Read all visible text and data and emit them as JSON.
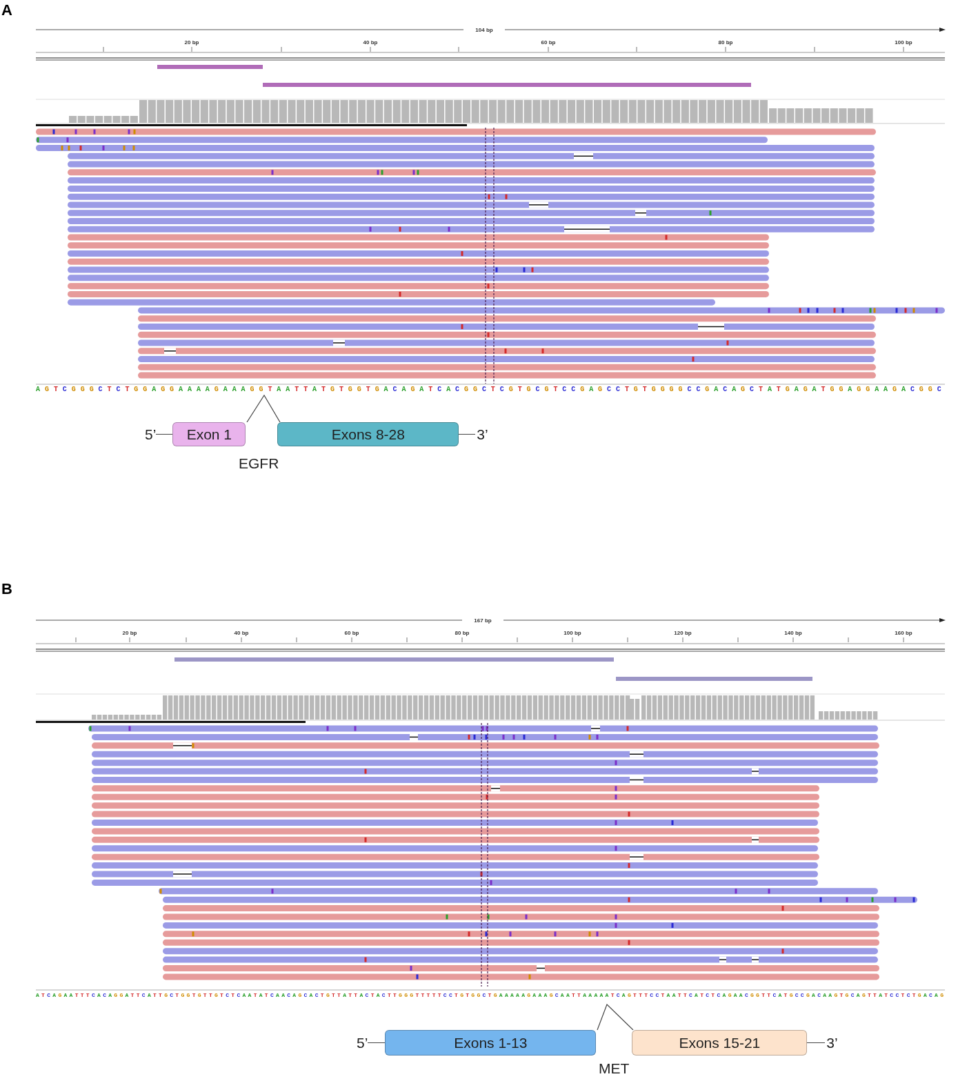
{
  "panels": [
    {
      "label": "A",
      "ruler": {
        "span": "104 bp",
        "ticks": [
          "20 bp",
          "40 bp",
          "60 bp",
          "80 bp",
          "100 bp"
        ]
      },
      "reads": [
        {
          "color": "#e69b9b"
        },
        {
          "color": "#9b9be6"
        },
        {
          "color": "#9b9be6"
        },
        {
          "color": "#9b9be6"
        },
        {
          "color": "#9b9be6"
        },
        {
          "color": "#e69b9b"
        },
        {
          "color": "#9b9be6"
        },
        {
          "color": "#9b9be6"
        },
        {
          "color": "#9b9be6"
        },
        {
          "color": "#9b9be6"
        },
        {
          "color": "#9b9be6"
        },
        {
          "color": "#9b9be6"
        },
        {
          "color": "#9b9be6"
        },
        {
          "color": "#e69b9b"
        },
        {
          "color": "#e69b9b"
        },
        {
          "color": "#9b9be6"
        },
        {
          "color": "#e69b9b"
        },
        {
          "color": "#9b9be6"
        },
        {
          "color": "#9b9be6"
        },
        {
          "color": "#e69b9b"
        },
        {
          "color": "#e69b9b"
        },
        {
          "color": "#9b9be6"
        },
        {
          "color": "#9b9be6"
        },
        {
          "color": "#e69b9b"
        },
        {
          "color": "#9b9be6"
        },
        {
          "color": "#e69b9b"
        },
        {
          "color": "#9b9be6"
        },
        {
          "color": "#e69b9b"
        },
        {
          "color": "#9b9be6"
        },
        {
          "color": "#e69b9b"
        },
        {
          "color": "#e69b9b"
        }
      ],
      "sequence": "AGTCGGGCTCTGGAGGAAAAGAAAGGTAATTATGTGGTGACAGATCACGGCTCGTGCGTCCGAGCCTGTGGGGCCGACAGCTATGAGATGGAGGAAGACGGC",
      "gene": {
        "five_prime": "5’",
        "exons": [
          {
            "label": "Exon 1",
            "color": "#e9b3ec"
          },
          {
            "label": "Exons 8-28",
            "color": "#5cb7c7"
          }
        ],
        "three_prime": "3’",
        "name": "EGFR"
      }
    },
    {
      "label": "B",
      "ruler": {
        "span": "167 bp",
        "ticks": [
          "20 bp",
          "40 bp",
          "60 bp",
          "80 bp",
          "100 bp",
          "120 bp",
          "140 bp",
          "160 bp"
        ]
      },
      "reads": [
        {
          "color": "#9b9be6"
        },
        {
          "color": "#9b9be6"
        },
        {
          "color": "#e69b9b"
        },
        {
          "color": "#9b9be6"
        },
        {
          "color": "#9b9be6"
        },
        {
          "color": "#9b9be6"
        },
        {
          "color": "#9b9be6"
        },
        {
          "color": "#e69b9b"
        },
        {
          "color": "#e69b9b"
        },
        {
          "color": "#e69b9b"
        },
        {
          "color": "#e69b9b"
        },
        {
          "color": "#9b9be6"
        },
        {
          "color": "#e69b9b"
        },
        {
          "color": "#e69b9b"
        },
        {
          "color": "#9b9be6"
        },
        {
          "color": "#e69b9b"
        },
        {
          "color": "#9b9be6"
        },
        {
          "color": "#9b9be6"
        },
        {
          "color": "#9b9be6"
        },
        {
          "color": "#9b9be6"
        },
        {
          "color": "#9b9be6"
        },
        {
          "color": "#e69b9b"
        },
        {
          "color": "#e69b9b"
        },
        {
          "color": "#9b9be6"
        },
        {
          "color": "#e69b9b"
        },
        {
          "color": "#e69b9b"
        },
        {
          "color": "#9b9be6"
        },
        {
          "color": "#9b9be6"
        },
        {
          "color": "#e69b9b"
        },
        {
          "color": "#e69b9b"
        }
      ],
      "sequence": "ATCAGAATTTCACAGGATTCATTGCTGGTGTTGTCTCAATATCAACAGCACTGTTATTACTACTTGGGTTTTTCCTGTGGCTGAAAAAGAAAGCAATTAAAAATCAGTTTCCTAATTCATCTCAGAACGGTTCATGCCGACAAGTGCAGTTATCCTCTGACAG",
      "gene": {
        "five_prime": "5’",
        "exons": [
          {
            "label": "Exons 1-13",
            "color": "#74b5ee"
          },
          {
            "label": "Exons 15-21",
            "color": "#fde3cc"
          }
        ],
        "three_prime": "3’",
        "name": "MET"
      }
    }
  ]
}
